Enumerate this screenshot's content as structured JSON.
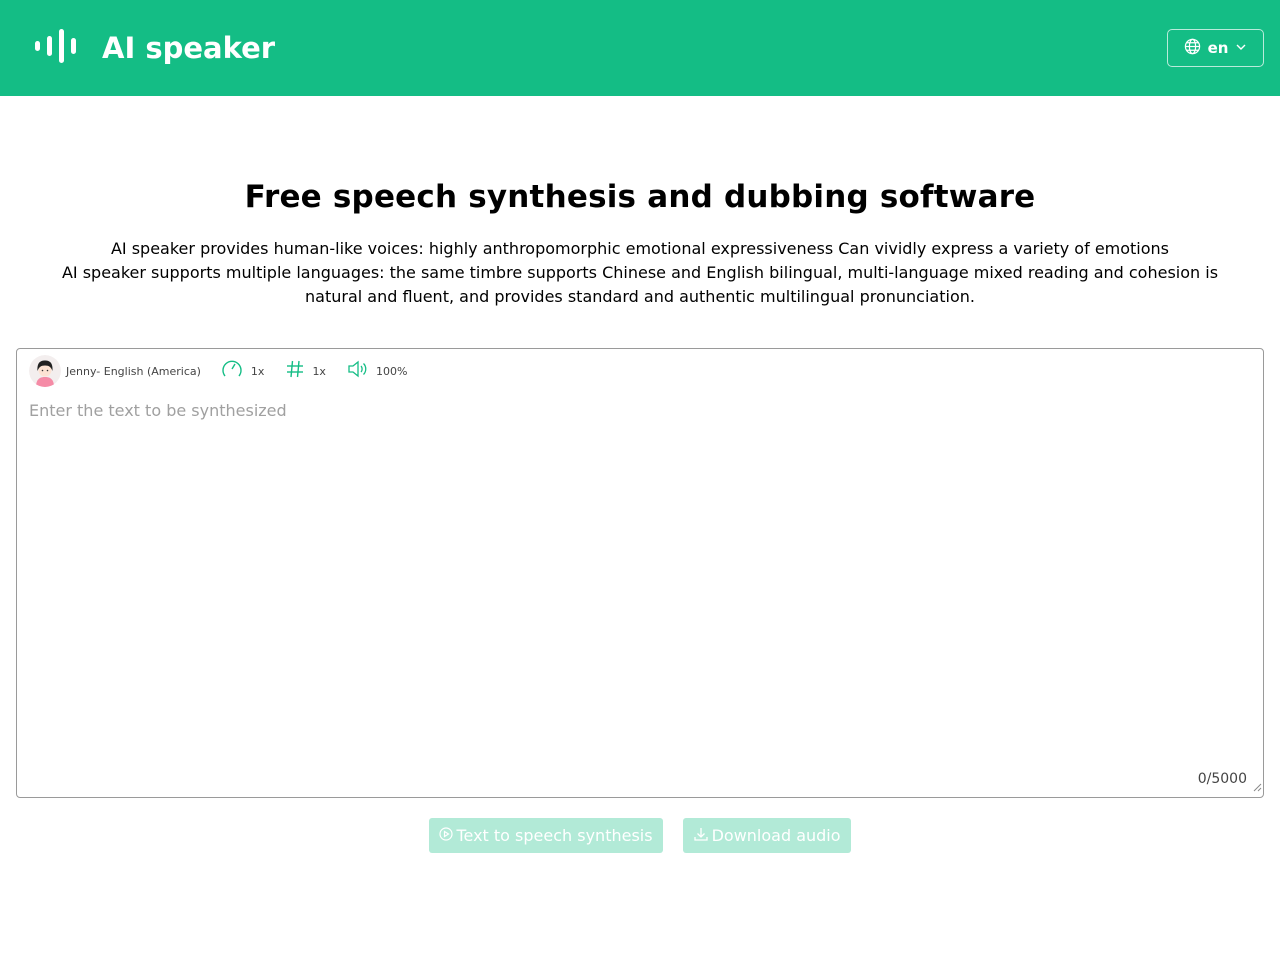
{
  "header": {
    "app_title": "AI speaker",
    "language": "en"
  },
  "hero": {
    "title": "Free speech synthesis and dubbing software",
    "desc_line1": "AI speaker provides human-like voices: highly anthropomorphic emotional expressiveness Can vividly express a variety of emotions",
    "desc_line2": "AI speaker supports multiple languages: the same timbre supports Chinese and English bilingual, multi-language mixed reading and cohesion is natural and fluent, and provides standard and authentic multilingual pronunciation."
  },
  "editor": {
    "voice_label": "Jenny- English (America)",
    "speed": "1x",
    "pitch": "1x",
    "volume": "100%",
    "placeholder": "Enter the text to be synthesized",
    "char_count": "0/5000"
  },
  "actions": {
    "synthesize_label": "Text to speech synthesis",
    "download_label": "Download audio"
  },
  "colors": {
    "brand": "#14bd85",
    "button_disabled": "#b2ead7"
  }
}
